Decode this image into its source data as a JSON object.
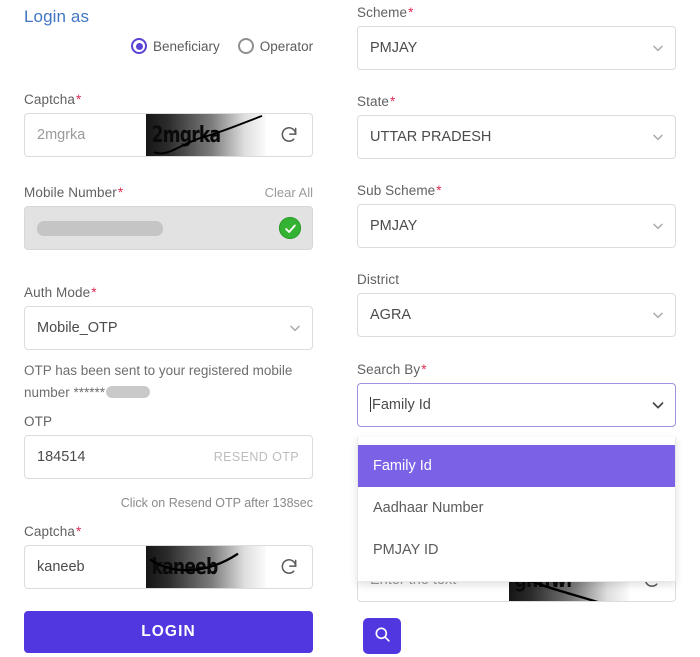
{
  "left": {
    "login_as_heading": "Login as",
    "roles": [
      {
        "label": "Beneficiary",
        "selected": true
      },
      {
        "label": "Operator",
        "selected": false
      }
    ],
    "captcha_top": {
      "label": "Captcha",
      "required": true,
      "placeholder": "2mgrka",
      "image_text": "2mgrka",
      "refresh_icon": "refresh-icon"
    },
    "mobile": {
      "label": "Mobile Number",
      "required": true,
      "clear_all": "Clear All",
      "value": "",
      "verified_icon": "check-circle-icon",
      "disabled": true
    },
    "auth_mode": {
      "label": "Auth Mode",
      "required": true,
      "value": "Mobile_OTP",
      "chevron_icon": "chevron-down-icon"
    },
    "otp_note": "OTP has been sent to your registered mobile number ******",
    "otp": {
      "label": "OTP",
      "required": false,
      "value": "184514",
      "resend_label": "RESEND OTP"
    },
    "resend_hint": "Click on Resend OTP after 138sec",
    "captcha_bottom": {
      "label": "Captcha",
      "required": true,
      "value": "kaneeb",
      "image_text": "kaneeb",
      "refresh_icon": "refresh-icon"
    },
    "login_button": "LOGIN"
  },
  "right": {
    "scheme": {
      "label": "Scheme",
      "required": true,
      "value": "PMJAY",
      "chevron_icon": "chevron-down-icon"
    },
    "state": {
      "label": "State",
      "required": true,
      "value": "UTTAR PRADESH",
      "chevron_icon": "chevron-down-icon"
    },
    "sub_scheme": {
      "label": "Sub Scheme",
      "required": true,
      "value": "PMJAY",
      "chevron_icon": "chevron-down-icon"
    },
    "district": {
      "label": "District",
      "required": false,
      "value": "AGRA",
      "chevron_icon": "chevron-down-icon"
    },
    "search_by": {
      "label": "Search By",
      "required": true,
      "value": "Family Id",
      "chevron_icon": "chevron-down-icon",
      "open": true,
      "options": [
        {
          "label": "Family Id",
          "selected": true
        },
        {
          "label": "Aadhaar Number",
          "selected": false
        },
        {
          "label": "PMJAY ID",
          "selected": false
        }
      ]
    },
    "captcha": {
      "placeholder": "Enter the text",
      "image_text": "gnffwf",
      "refresh_icon": "refresh-icon"
    },
    "search_button_icon": "search-icon"
  },
  "colors": {
    "accent": "#5137e0",
    "dropdown_highlight": "#7b61e6",
    "heading_blue": "#4176c4",
    "required_red": "#e02b54",
    "verified_green": "#34b233"
  }
}
